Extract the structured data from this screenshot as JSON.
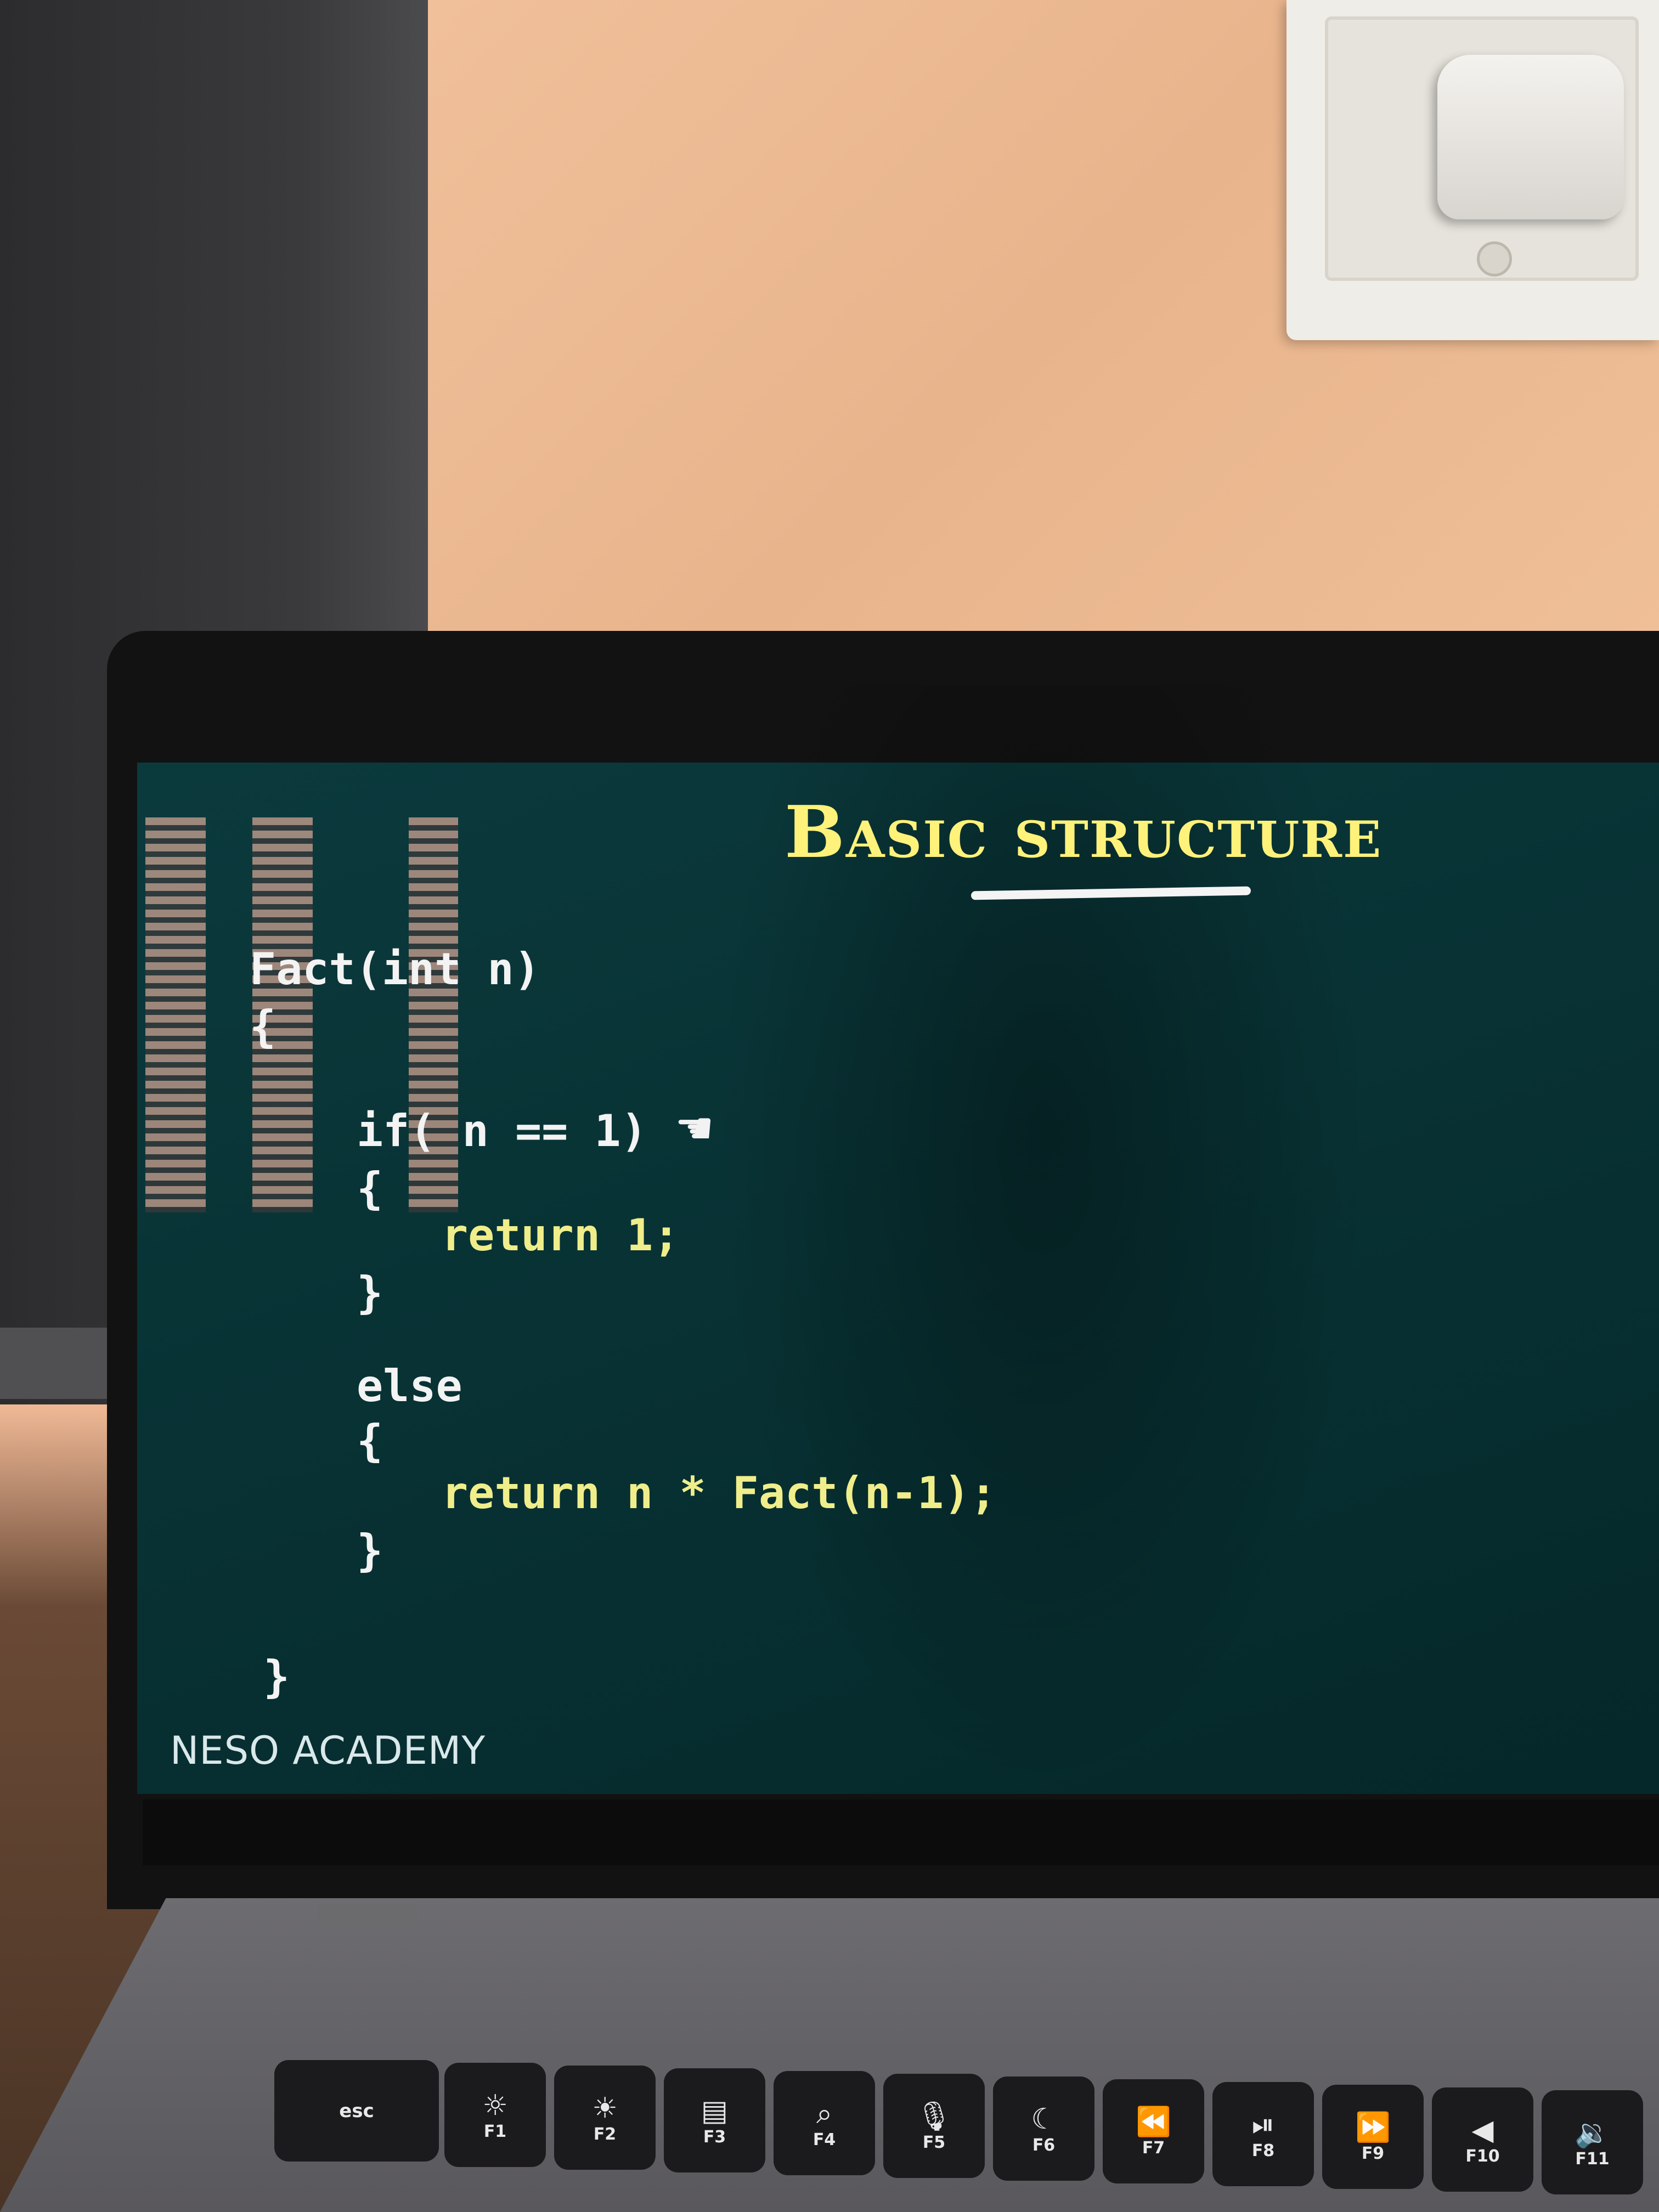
{
  "slide": {
    "title": "Basic structure",
    "brand": "NESO ACADEMY",
    "code": [
      "Fact(int n)",
      "{",
      "if( n == 1)",
      "{",
      "return 1;",
      "}",
      "else",
      "{",
      "return n * Fact(n-1);",
      "}",
      "}"
    ]
  },
  "keyboard": {
    "keys": [
      {
        "label": "esc",
        "icon": ""
      },
      {
        "label": "F1",
        "icon": "brightness-down-icon"
      },
      {
        "label": "F2",
        "icon": "brightness-up-icon"
      },
      {
        "label": "F3",
        "icon": "mission-control-icon"
      },
      {
        "label": "F4",
        "icon": "search-icon"
      },
      {
        "label": "F5",
        "icon": "microphone-icon"
      },
      {
        "label": "F6",
        "icon": "moon-icon"
      },
      {
        "label": "F7",
        "icon": "rewind-icon"
      },
      {
        "label": "F8",
        "icon": "play-pause-icon"
      },
      {
        "label": "F9",
        "icon": "fast-forward-icon"
      },
      {
        "label": "F10",
        "icon": "mute-icon"
      },
      {
        "label": "F11",
        "icon": "volume-down-icon"
      }
    ]
  }
}
